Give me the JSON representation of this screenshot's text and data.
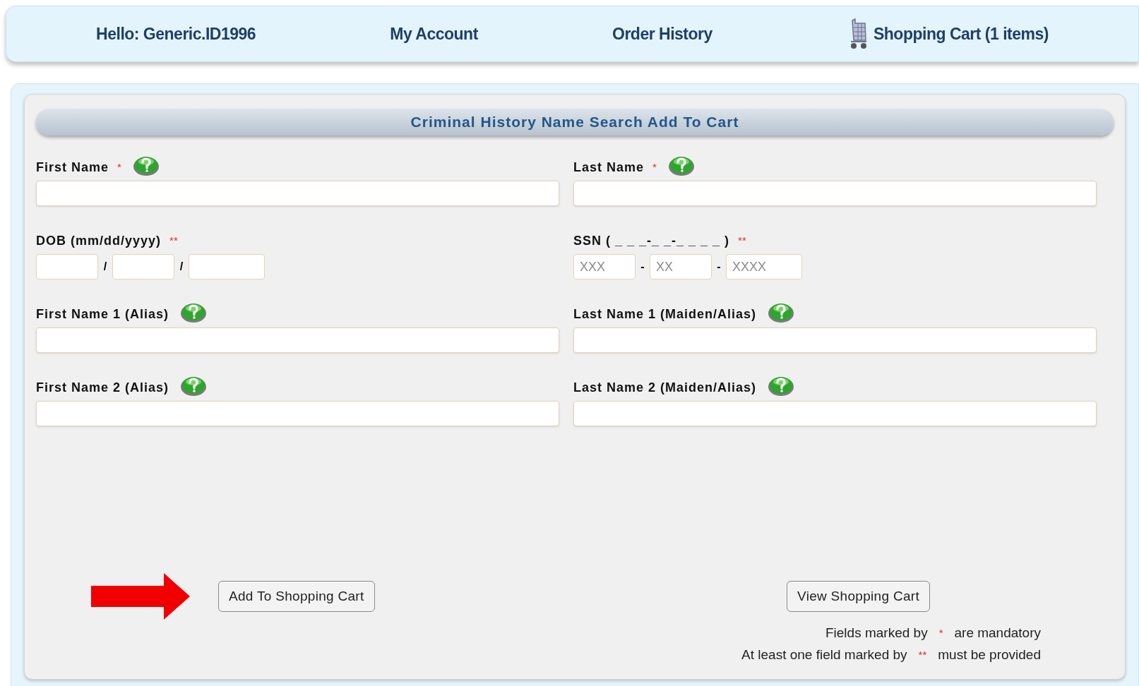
{
  "nav": [
    {
      "kind": "text",
      "label": "Hello: Generic.ID1996"
    },
    {
      "kind": "text",
      "label": "My Account"
    },
    {
      "kind": "text",
      "label": "Order History"
    },
    {
      "kind": "cart",
      "label": "Shopping Cart (1 items)"
    }
  ],
  "form": {
    "title": "Criminal History Name Search Add To Cart",
    "fields": [
      {
        "kind": "text",
        "label": "First Name",
        "marker": "*",
        "help": true
      },
      {
        "kind": "text",
        "label": "Last Name",
        "marker": "*",
        "help": true
      },
      {
        "kind": "split",
        "label": "DOB (mm/dd/yyyy)",
        "marker": "**",
        "help": false,
        "parts": [
          {
            "kind": "normal",
            "separator": "/"
          },
          {
            "kind": "normal",
            "separator": "/"
          },
          {
            "kind": "wide"
          }
        ]
      },
      {
        "kind": "split",
        "label": "SSN ( _ _ _-_ _-_ _ _ _ )",
        "marker": "**",
        "help": false,
        "parts": [
          {
            "placeholder": "XXX",
            "kind": "normal",
            "separator": "-"
          },
          {
            "placeholder": "XX",
            "kind": "normal",
            "separator": "-"
          },
          {
            "placeholder": "XXXX",
            "kind": "wide"
          }
        ]
      },
      {
        "kind": "text",
        "label": "First Name 1 (Alias)",
        "help": true
      },
      {
        "kind": "text",
        "label": "Last Name 1 (Maiden/Alias)",
        "help": true
      },
      {
        "kind": "text",
        "label": "First Name 2 (Alias)",
        "help": true
      },
      {
        "kind": "text",
        "label": "Last Name 2 (Maiden/Alias)",
        "help": true
      }
    ],
    "buttons": [
      {
        "label": "Add To Shopping Cart",
        "arrow": true
      },
      {
        "label": "View Shopping Cart",
        "arrow": false
      }
    ],
    "notes": [
      {
        "before": "Fields marked by",
        "marker": "*",
        "after": "are mandatory"
      },
      {
        "before": "At least one field marked by",
        "marker": "**",
        "after": "must be provided"
      }
    ]
  }
}
